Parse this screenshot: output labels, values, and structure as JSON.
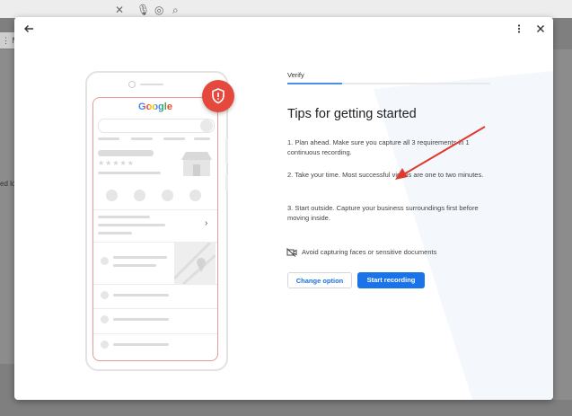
{
  "background": {
    "tab_label": "M",
    "edge_label": "ed lo"
  },
  "dialog": {
    "back_icon": "back-arrow-icon",
    "menu_icon": "more-vert-icon",
    "close_icon": "close-icon"
  },
  "illustration": {
    "brand": "Google",
    "brand_colors": [
      "#4285F4",
      "#EA4335",
      "#FBBC05",
      "#4285F4",
      "#34A853",
      "#EA4335"
    ],
    "badge_color": "#e5483c",
    "badge_icon": "shield-alert-icon"
  },
  "content": {
    "step_label": "Verify",
    "step_progress": 0.27,
    "title": "Tips for getting started",
    "tips": [
      "1. Plan ahead. Make sure you capture all 3 requirements in 1 continuous recording.",
      "2. Take your time. Most successful videos are one to two minutes.",
      "3. Start outside. Capture your business surroundings first before moving inside."
    ],
    "note": "Avoid capturing faces or sensitive documents",
    "change_option": "Change option",
    "start_recording": "Start recording"
  },
  "colors": {
    "accent": "#1a73e8",
    "annotation_arrow": "#e03a2f"
  }
}
